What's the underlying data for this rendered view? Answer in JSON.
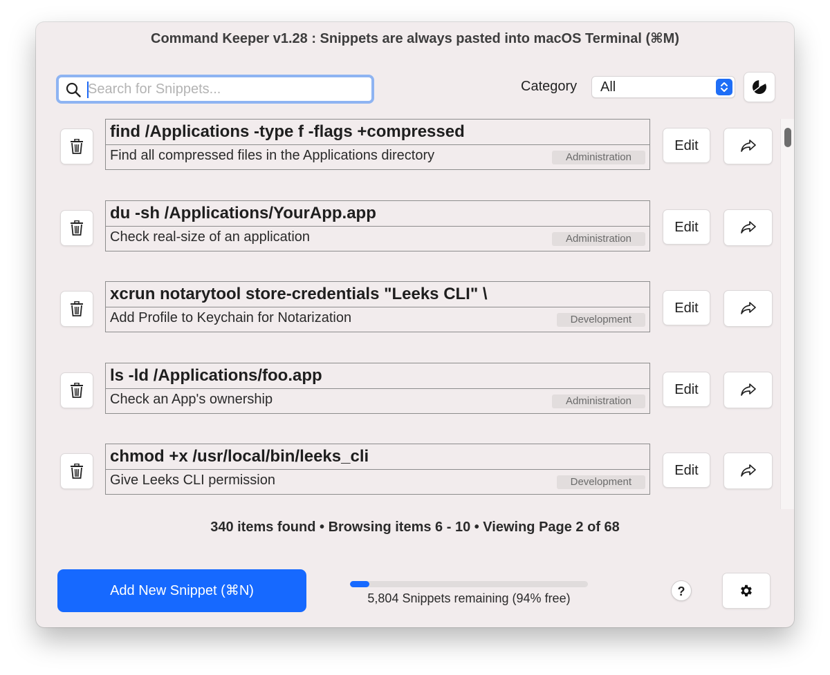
{
  "window": {
    "title": "Command Keeper v1.28 : Snippets are always pasted into macOS Terminal (⌘M)"
  },
  "search": {
    "placeholder": "Search for Snippets...",
    "value": "",
    "icon": "search-icon"
  },
  "category": {
    "label": "Category",
    "selected": "All"
  },
  "snippets": [
    {
      "command": "find /Applications -type f -flags +compressed",
      "description": "Find all compressed files in the Applications directory",
      "category": "Administration"
    },
    {
      "command": "du -sh /Applications/YourApp.app",
      "description": "Check real-size of an application",
      "category": "Administration"
    },
    {
      "command": "xcrun notarytool store-credentials \"Leeks CLI\" \\",
      "description": "Add Profile to Keychain for Notarization",
      "category": "Development"
    },
    {
      "command": "ls -ld /Applications/foo.app",
      "description": "Check an App's ownership",
      "category": "Administration"
    },
    {
      "command": "chmod +x /usr/local/bin/leeks_cli",
      "description": "Give Leeks CLI permission",
      "category": "Development"
    }
  ],
  "row_actions": {
    "edit_label": "Edit"
  },
  "status": {
    "summary": "340 items found • Browsing items 6 - 10 • Viewing Page 2 of 68"
  },
  "footer": {
    "add_label": "Add New Snippet (⌘N)",
    "remaining_text": "5,804 Snippets remaining (94% free)",
    "usage_fraction": 0.08,
    "help_label": "?"
  },
  "colors": {
    "accent": "#1669ff",
    "window_bg": "#f2eced"
  }
}
